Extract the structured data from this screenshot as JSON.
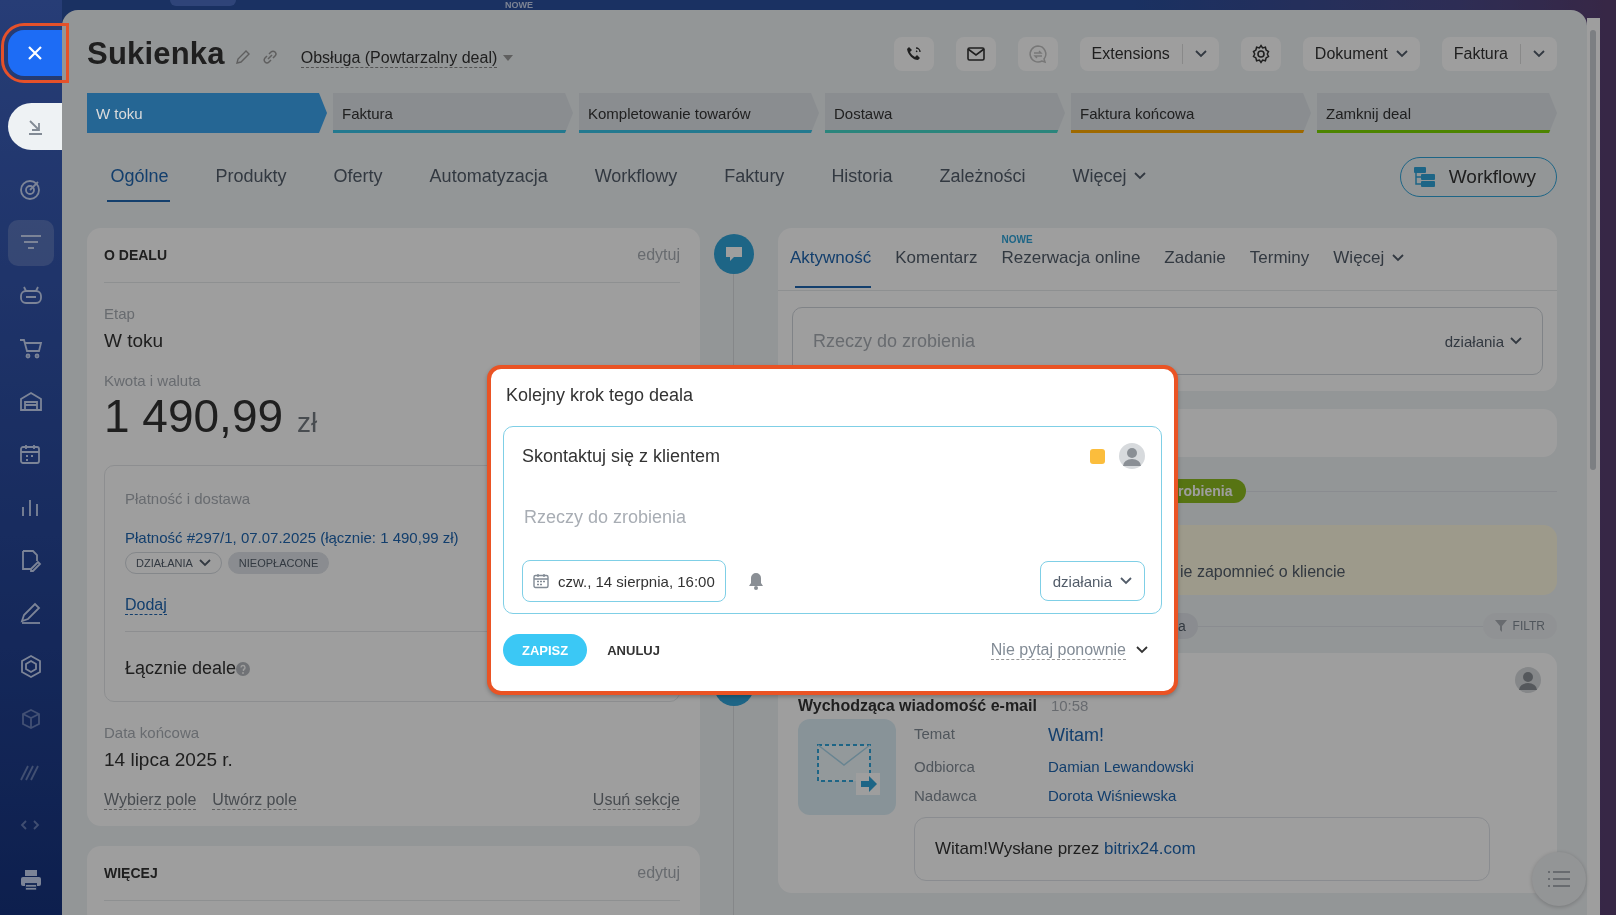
{
  "top_bar": {
    "badge": "NOWE"
  },
  "header": {
    "title": "Sukienka",
    "pipeline": "Obsługa (Powtarzalny deal)",
    "actions": [
      {
        "kind": "phone",
        "disabled": false
      },
      {
        "kind": "mail",
        "disabled": false
      },
      {
        "kind": "chat",
        "disabled": true
      },
      {
        "kind": "split",
        "label": "Extensions"
      },
      {
        "kind": "gear",
        "disabled": false
      },
      {
        "kind": "dropdown",
        "label": "Dokument"
      },
      {
        "kind": "split",
        "label": "Faktura"
      }
    ]
  },
  "stages": [
    {
      "label": "W toku",
      "selected": true,
      "color": "#256694"
    },
    {
      "label": "Faktura",
      "selected": false,
      "color": "#23798f"
    },
    {
      "label": "Kompletowanie towarów",
      "selected": false,
      "color": "#23798f"
    },
    {
      "label": "Dostawa",
      "selected": false,
      "color": "#2b857c"
    },
    {
      "label": "Faktura końcowa",
      "selected": false,
      "color": "#9e6900"
    },
    {
      "label": "Zamknij deal",
      "selected": false,
      "color": "#4c8400"
    }
  ],
  "tabs": [
    {
      "label": "Ogólne",
      "selected": true,
      "dropdown": false
    },
    {
      "label": "Produkty",
      "selected": false,
      "dropdown": false
    },
    {
      "label": "Oferty",
      "selected": false,
      "dropdown": false
    },
    {
      "label": "Automatyzacja",
      "selected": false,
      "dropdown": false
    },
    {
      "label": "Workflowy",
      "selected": false,
      "dropdown": false
    },
    {
      "label": "Faktury",
      "selected": false,
      "dropdown": false
    },
    {
      "label": "Historia",
      "selected": false,
      "dropdown": false
    },
    {
      "label": "Zależności",
      "selected": false,
      "dropdown": false
    },
    {
      "label": "Więcej",
      "selected": false,
      "dropdown": true
    }
  ],
  "workflow_button": {
    "label": "Workflowy"
  },
  "deal_section": {
    "title": "O DEALU",
    "edit": "edytuj",
    "stage_label": "Etap",
    "stage_value": "W toku",
    "amount_label": "Kwota i waluta",
    "amount": "1 490,99",
    "currency": "zł",
    "payment": {
      "title": "Płatność i dostawa",
      "link": "Płatność #297/1, 07.07.2025 (łącznie: 1 490,99 zł)",
      "actions": "DZIAŁANIA",
      "status": "NIEOPŁACONE",
      "add": "Dodaj"
    },
    "total_label": "Łącznie deale",
    "end_label": "Data końcowa",
    "end_value": "14 lipca 2025 r.",
    "links": [
      "Wybierz pole",
      "Utwórz pole"
    ],
    "remove": "Usuń sekcje"
  },
  "more_section": {
    "title": "WIĘCEJ",
    "edit": "edytuj"
  },
  "activity": {
    "tabs": [
      {
        "label": "Aktywność",
        "selected": true,
        "dropdown": false
      },
      {
        "label": "Komentarz",
        "selected": false,
        "dropdown": false
      },
      {
        "label": "Rezerwacja online",
        "selected": false,
        "dropdown": false,
        "badge": "NOWE"
      },
      {
        "label": "Zadanie",
        "selected": false,
        "dropdown": false
      },
      {
        "label": "Terminy",
        "selected": false,
        "dropdown": false
      },
      {
        "label": "Więcej",
        "selected": false,
        "dropdown": true
      }
    ],
    "placeholder": "Rzeczy do zrobienia",
    "action": "działania",
    "todo_badge": "robienia",
    "reminder": "ie zapomnieć o kliencie",
    "history_badge": "a",
    "filter": "FILTR",
    "email": {
      "title": "Wychodząca wiadomość e-mail",
      "time": "10:58",
      "fields": [
        {
          "label": "Temat",
          "value": "Witam!"
        },
        {
          "label": "Odbiorca",
          "value": "Damian Lewandowski"
        },
        {
          "label": "Nadawca",
          "value": "Dorota Wiśniewska"
        }
      ],
      "body": "Witam!Wysłane przez ",
      "body_link": "bitrix24.com"
    }
  },
  "modal": {
    "title": "Kolejny krok tego deala",
    "task": "Skontaktuj się z klientem",
    "flag": {
      "color": "#fbbd3c"
    },
    "placeholder": "Rzeczy do zrobienia",
    "date": "czw., 14 sierpnia, 16:00",
    "action": "działania",
    "save": "ZAPISZ",
    "cancel": "ANULUJ",
    "dont_ask": "Nie pytaj ponownie"
  }
}
